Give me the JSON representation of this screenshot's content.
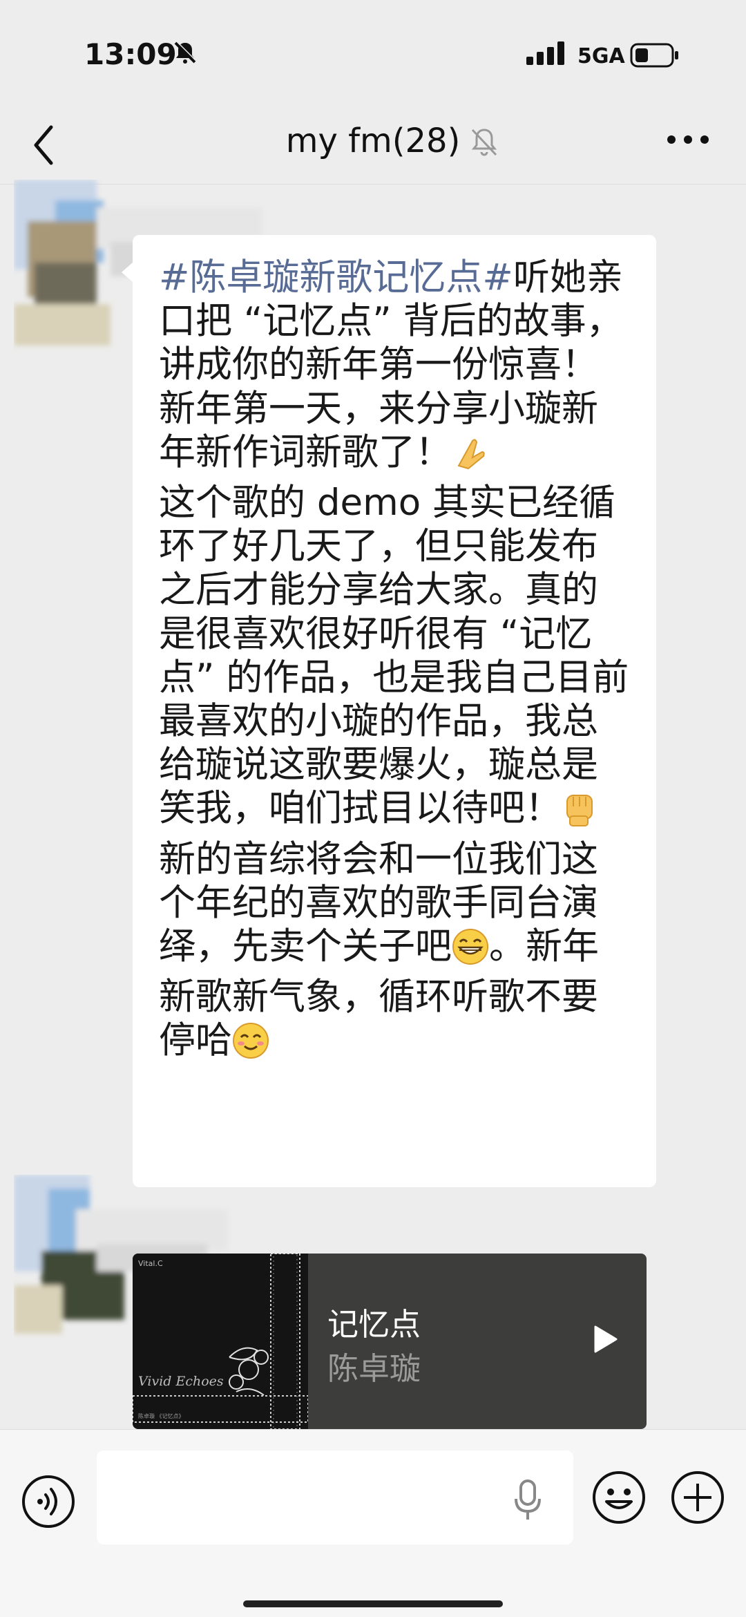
{
  "status_bar": {
    "time": "13:09",
    "network": "5GA",
    "icons": [
      "bell-slash-icon",
      "signal-icon",
      "battery-icon"
    ]
  },
  "nav": {
    "title": "my fm(28)",
    "icons": [
      "chevron-left-icon",
      "bell-slash-icon",
      "more-icon"
    ]
  },
  "messages": [
    {
      "type": "text",
      "hashtag": "#陈卓璇新歌记忆点#",
      "part1": "听她亲口把 “记忆点” 背后的故事，讲成你的新年第一份惊喜！\n新年第一天，来分享小璇新年新作词新歌了！",
      "part2": "\n这个歌的 demo 其实已经循环了好几天了，但只能发布之后才能分享给大家。真的是很喜欢很好听很有 “记忆点” 的作品，也是我自己目前最喜欢的小璇的作品，我总给璇说这歌要爆火，璇总是笑我，咱们拭目以待吧！",
      "part3": "\n新的音综将会和一位我们这个年纪的喜欢的歌手同台演绎，先卖个关子吧",
      "part4": "。新年新歌新气象，循环听歌不要停哈",
      "emojis": [
        "praying-hands-emoji",
        "raised-fist-emoji",
        "grinning-face-emoji",
        "smiling-face-emoji"
      ]
    },
    {
      "type": "music",
      "song_title": "记忆点",
      "artist": "陈卓璇",
      "album_cover_text": "Vivid Echoes",
      "album_top_text": "Vital.C",
      "album_bottom_text": "陈卓璇 《记忆点》",
      "icons": [
        "play-icon"
      ]
    }
  ],
  "input_bar": {
    "placeholder": "",
    "icons": [
      "voice-icon",
      "microphone-icon",
      "emoji-icon",
      "plus-icon"
    ]
  },
  "colors": {
    "background": "#ededed",
    "bubble": "#ffffff",
    "hashtag": "#576b95",
    "music_card": "#3d3e3b"
  }
}
